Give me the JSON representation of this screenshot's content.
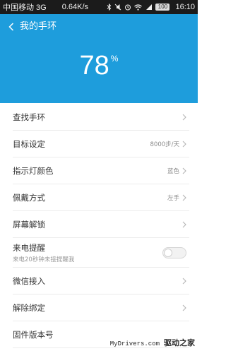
{
  "status_bar": {
    "carrier": "中国移动 3G",
    "speed": "0.64K/s",
    "battery": "100",
    "time": "16:10"
  },
  "header": {
    "title": "我的手环",
    "battery_value": "78",
    "battery_unit": "%",
    "color": "#1e9ddc"
  },
  "settings": {
    "find_band": {
      "label": "查找手环"
    },
    "goal": {
      "label": "目标设定",
      "value": "8000步/天"
    },
    "led_color": {
      "label": "指示灯颜色",
      "value": "蓝色"
    },
    "wear_mode": {
      "label": "佩戴方式",
      "value": "左手"
    },
    "screen_unlock": {
      "label": "屏幕解锁"
    },
    "call_alert": {
      "label": "来电提醒",
      "sublabel": "来电20秒钟未接提醒我",
      "enabled": false
    },
    "wechat": {
      "label": "微信接入"
    },
    "unbind": {
      "label": "解除绑定"
    },
    "firmware": {
      "label": "固件版本号"
    }
  },
  "watermark": {
    "domain": "MyDrivers.com",
    "cn": "驱动之家"
  }
}
